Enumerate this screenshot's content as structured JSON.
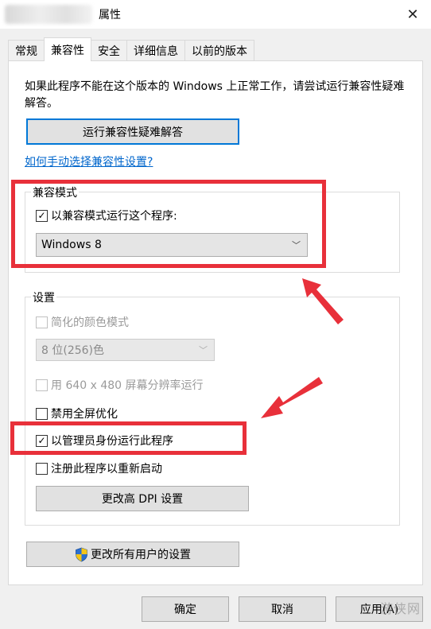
{
  "window": {
    "title": "属性",
    "close_glyph": "✕"
  },
  "tabs": [
    {
      "label": "常规"
    },
    {
      "label": "兼容性"
    },
    {
      "label": "安全"
    },
    {
      "label": "详细信息"
    },
    {
      "label": "以前的版本"
    }
  ],
  "compat": {
    "intro": "如果此程序不能在这个版本的 Windows 上正常工作，请尝试运行兼容性疑难解答。",
    "troubleshoot_button": "运行兼容性疑难解答",
    "manual_link": "如何手动选择兼容性设置?",
    "mode_group": {
      "label": "兼容模式",
      "checkbox_label": "以兼容模式运行这个程序:",
      "checked": true,
      "selected_os": "Windows 8"
    },
    "settings_group": {
      "label": "设置",
      "reduced_color": {
        "label": "简化的颜色模式",
        "checked": false,
        "disabled": true
      },
      "color_select": {
        "value": "8 位(256)色",
        "disabled": true
      },
      "res_640": {
        "label": "用 640 x 480 屏幕分辨率运行",
        "checked": false,
        "disabled": true
      },
      "disable_fullscreen": {
        "label": "禁用全屏优化",
        "checked": false
      },
      "run_as_admin": {
        "label": "以管理员身份运行此程序",
        "checked": true
      },
      "register_restart": {
        "label": "注册此程序以重新启动",
        "checked": false
      },
      "dpi_button": "更改高 DPI 设置"
    },
    "all_users_button": "更改所有用户的设置"
  },
  "footer": {
    "ok": "确定",
    "cancel": "取消",
    "apply": "应用(A)"
  },
  "watermark": "游侠网",
  "colors": {
    "annotation_red": "#e8303a",
    "link_blue": "#0066cc",
    "focus_blue": "#0078d7"
  }
}
